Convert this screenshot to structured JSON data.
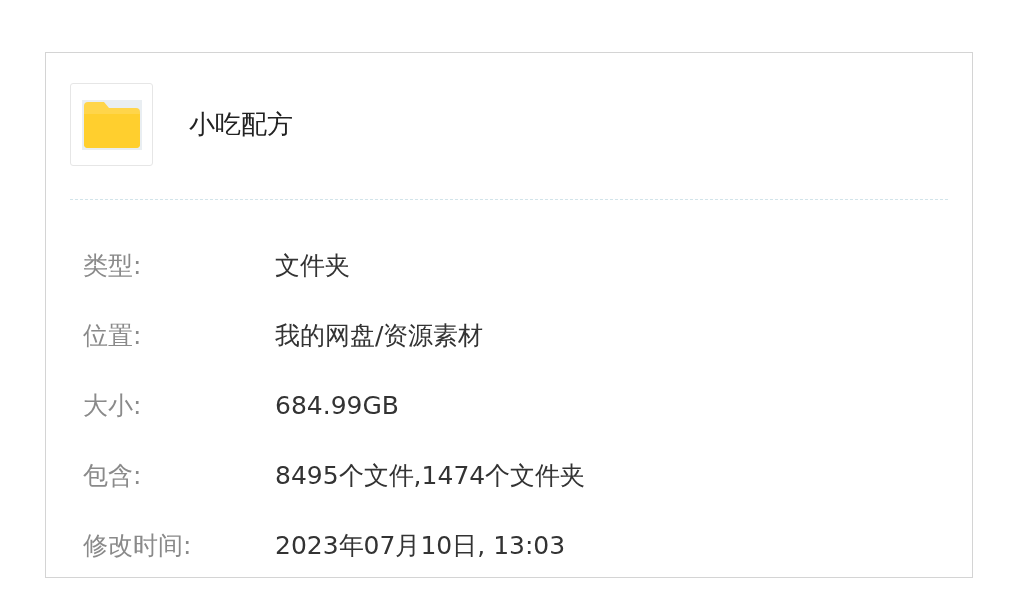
{
  "folder": {
    "name": "小吃配方"
  },
  "properties": [
    {
      "label": "类型:",
      "value": "文件夹"
    },
    {
      "label": "位置:",
      "value": "我的网盘/资源素材"
    },
    {
      "label": "大小:",
      "value": "684.99GB"
    },
    {
      "label": "包含:",
      "value": "8495个文件,1474个文件夹"
    },
    {
      "label": "修改时间:",
      "value": "2023年07月10日, 13:03"
    }
  ]
}
